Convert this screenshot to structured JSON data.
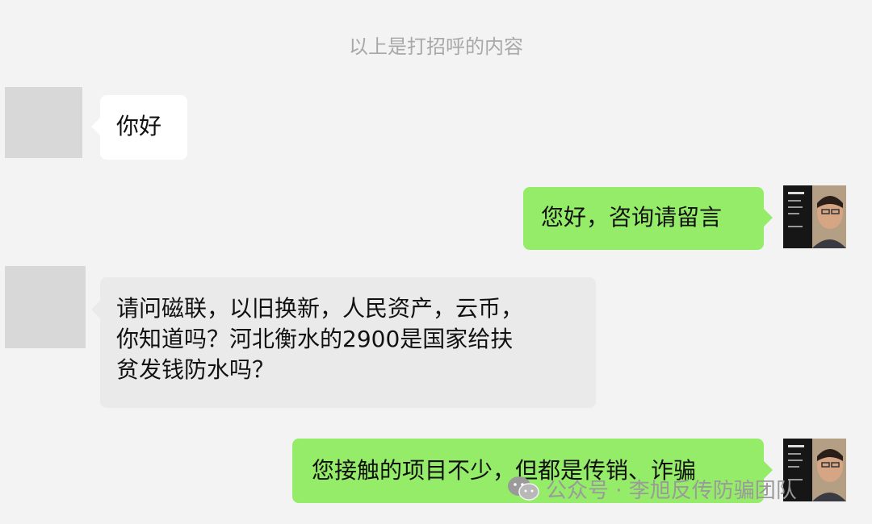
{
  "system_note": "以上是打招呼的内容",
  "messages": [
    {
      "sender": "other",
      "text": "你好"
    },
    {
      "sender": "self",
      "text": "您好，咨询请留言"
    },
    {
      "sender": "other",
      "lines": [
        "请问磁联，以旧换新，人民资产，云币，",
        "你知道吗？河北衡水的2900是国家给扶",
        "贫发钱防水吗？"
      ]
    },
    {
      "sender": "self",
      "text": "您接触的项目不少，但都是传销、诈骗"
    }
  ],
  "watermark": {
    "text": "公众号 · 李旭反传防骗团队",
    "icon": "wechat-icon"
  },
  "colors": {
    "self_bubble": "#95ec69",
    "other_bubble": "#ffffff",
    "background": "#f3f3f3"
  }
}
